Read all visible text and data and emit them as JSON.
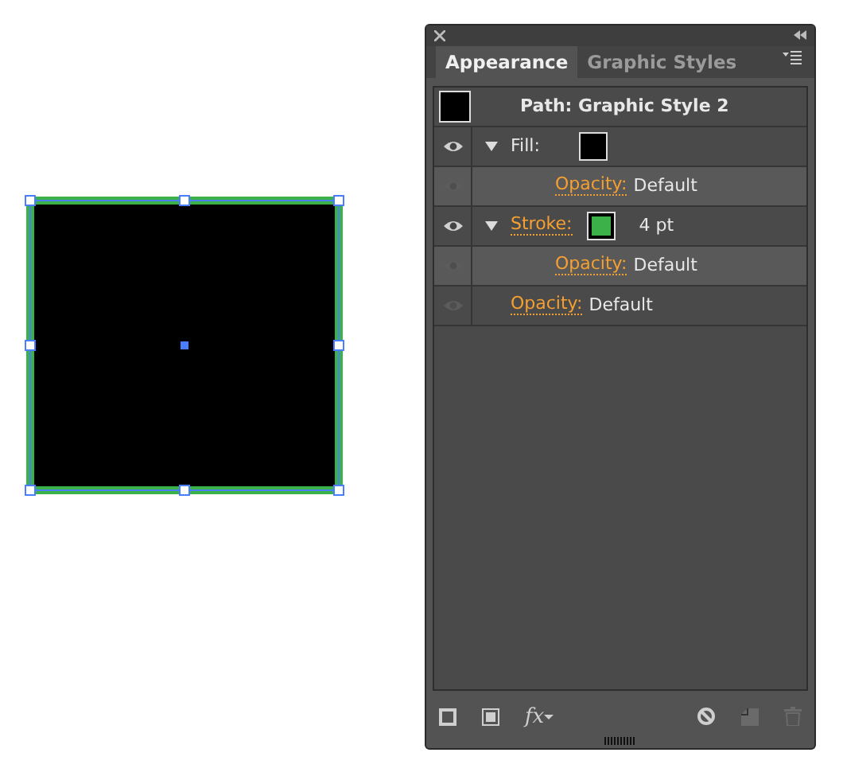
{
  "artwork": {
    "fill": {
      "color": "#000000"
    },
    "stroke": {
      "color": "#3cb14a"
    },
    "selected": true
  },
  "tabs": [
    {
      "label": "Appearance",
      "selected": true
    },
    {
      "label": "Graphic Styles",
      "selected": false
    }
  ],
  "header": {
    "title": "Path: Graphic Style 2",
    "color": "#000000"
  },
  "rows": [
    {
      "label": "Fill:",
      "link": false,
      "eye_active": true,
      "color": "#000000",
      "expanded": true,
      "children": [
        {
          "label": "Opacity:",
          "value": "Default",
          "link": true,
          "eye_active": false
        }
      ]
    },
    {
      "label": "Stroke:",
      "link": true,
      "eye_active": true,
      "color": "#3cb14a",
      "value": "4 pt",
      "expanded": true,
      "children": [
        {
          "label": "Opacity:",
          "value": "Default",
          "link": true,
          "eye_active": false
        }
      ]
    },
    {
      "label": "Opacity:",
      "value": "Default",
      "link": true,
      "eye_active": false
    }
  ],
  "footer": [
    {
      "kind": "add-stroke",
      "disabled": false
    },
    {
      "kind": "add-fill",
      "disabled": false
    },
    {
      "kind": "fx",
      "label": "fx",
      "disabled": false
    },
    {
      "kind": "spacer"
    },
    {
      "kind": "clear",
      "disabled": false
    },
    {
      "kind": "duplicate",
      "disabled": true
    },
    {
      "kind": "delete",
      "disabled": true
    }
  ]
}
